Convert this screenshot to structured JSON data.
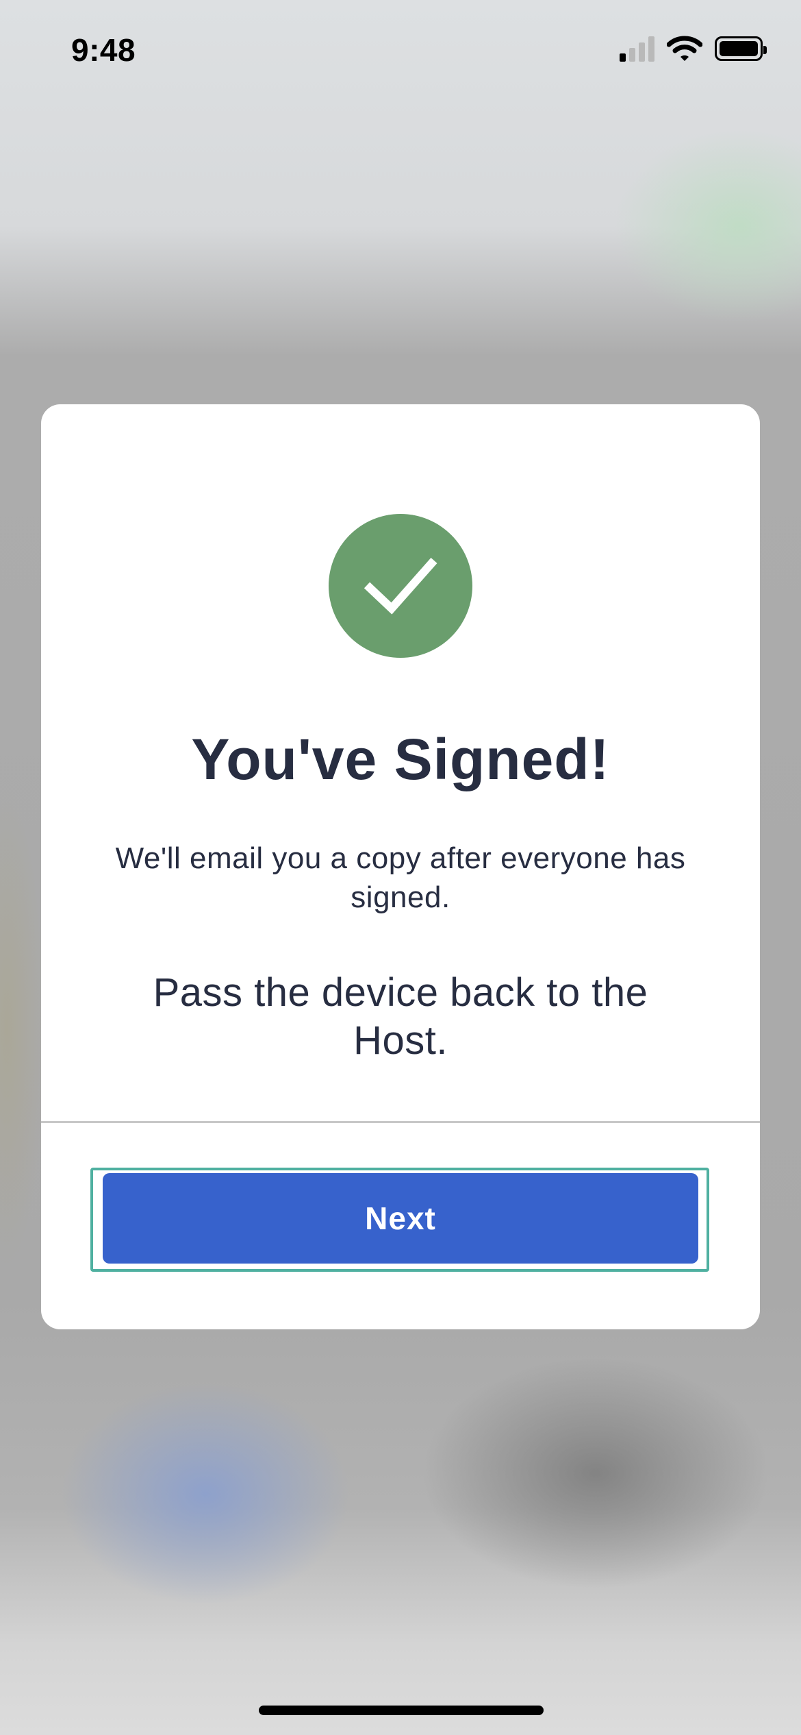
{
  "status_bar": {
    "time": "9:48",
    "signal_icon": "cellular-signal-icon",
    "wifi_icon": "wifi-icon",
    "battery_icon": "battery-icon"
  },
  "modal": {
    "icon": "checkmark-icon",
    "icon_color": "#6a9e6d",
    "title": "You've Signed!",
    "subtitle": "We'll email you a copy after everyone has signed.",
    "instruction": "Pass the device back to the Host.",
    "next_button_label": "Next",
    "button_color": "#3762cc",
    "focus_ring_color": "#4fb0a0"
  }
}
